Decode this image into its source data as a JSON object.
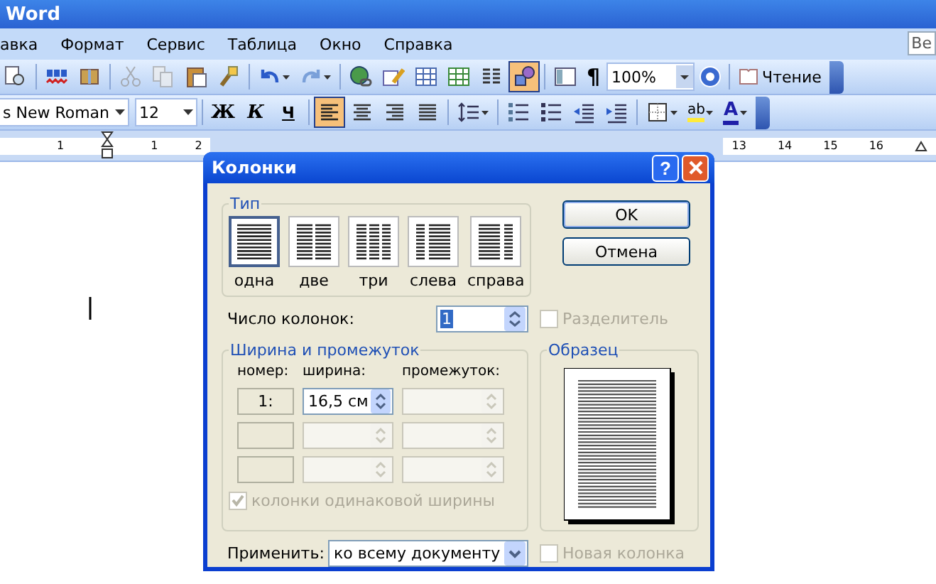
{
  "window": {
    "title": "Word"
  },
  "menu": [
    "авка",
    "Формат",
    "Сервис",
    "Таблица",
    "Окно",
    "Справка"
  ],
  "question_box": "Ве",
  "standard_toolbar": {
    "tools": [
      {
        "kind": "preview",
        "selected": false,
        "disabled": false,
        "dropdown": false
      },
      {
        "kind": "spelling",
        "selected": false,
        "disabled": false,
        "dropdown": false
      },
      {
        "kind": "research",
        "selected": false,
        "disabled": false,
        "dropdown": false
      },
      {
        "kind": "cut",
        "selected": false,
        "disabled": true,
        "dropdown": false
      },
      {
        "kind": "copy",
        "selected": false,
        "disabled": true,
        "dropdown": false
      },
      {
        "kind": "paste",
        "selected": false,
        "disabled": false,
        "dropdown": false
      },
      {
        "kind": "format-painter",
        "selected": false,
        "disabled": false,
        "dropdown": false
      },
      {
        "kind": "undo",
        "selected": false,
        "disabled": false,
        "dropdown": true
      },
      {
        "kind": "redo",
        "selected": false,
        "disabled": false,
        "dropdown": true
      },
      {
        "kind": "hyperlink",
        "selected": false,
        "disabled": false,
        "dropdown": false
      },
      {
        "kind": "tables-borders",
        "selected": false,
        "disabled": false,
        "dropdown": false
      },
      {
        "kind": "insert-table",
        "selected": false,
        "disabled": false,
        "dropdown": false
      },
      {
        "kind": "insert-worksheet",
        "selected": false,
        "disabled": false,
        "dropdown": false
      },
      {
        "kind": "columns",
        "selected": false,
        "disabled": false,
        "dropdown": false
      },
      {
        "kind": "drawing",
        "selected": true,
        "disabled": false,
        "dropdown": false
      },
      {
        "kind": "document-map",
        "selected": false,
        "disabled": false,
        "dropdown": false
      }
    ],
    "pilcrow": "¶",
    "zoom": "100%",
    "reading": "Чтение"
  },
  "formatting_toolbar": {
    "font": "s New Roman",
    "size": "12",
    "styles": [
      "Ж",
      "К",
      "Ч"
    ],
    "tools": [
      {
        "kind": "align-left",
        "selected": true,
        "dropdown": false
      },
      {
        "kind": "align-center",
        "selected": false,
        "dropdown": false
      },
      {
        "kind": "align-right",
        "selected": false,
        "dropdown": false
      },
      {
        "kind": "justify",
        "selected": false,
        "dropdown": false
      },
      {
        "kind": "line-spacing",
        "selected": false,
        "dropdown": true
      },
      {
        "kind": "numbering",
        "selected": false,
        "dropdown": false
      },
      {
        "kind": "bullets",
        "selected": false,
        "dropdown": false
      },
      {
        "kind": "outdent",
        "selected": false,
        "dropdown": false
      },
      {
        "kind": "indent",
        "selected": false,
        "dropdown": false
      },
      {
        "kind": "borders",
        "selected": false,
        "dropdown": true
      },
      {
        "kind": "highlight",
        "selected": false,
        "dropdown": true,
        "label": "ab"
      },
      {
        "kind": "font-color",
        "selected": false,
        "dropdown": true,
        "label": "A"
      }
    ]
  },
  "ruler": {
    "left_labels": [
      "1",
      "1",
      "2"
    ],
    "right_labels": [
      "13",
      "14",
      "15",
      "16"
    ]
  },
  "dialog": {
    "title": "Колонки",
    "help": "?",
    "type_group": {
      "title": "Тип",
      "presets": [
        {
          "kind": "one",
          "label": "одна",
          "selected": true
        },
        {
          "kind": "two",
          "label": "две",
          "selected": false
        },
        {
          "kind": "three",
          "label": "три",
          "selected": false
        },
        {
          "kind": "left",
          "label": "слева",
          "selected": false
        },
        {
          "kind": "right",
          "label": "справа",
          "selected": false
        }
      ]
    },
    "buttons": [
      "OK",
      "Отмена"
    ],
    "count_label": "Число колонок:",
    "count_value": "1",
    "separator": {
      "label": "Разделитель",
      "checked": false,
      "disabled": true
    },
    "width_group": {
      "title": "Ширина и промежуток",
      "headers": [
        "номер:",
        "ширина:",
        "промежуток:"
      ],
      "rows": [
        {
          "number": "1:",
          "width": "16,5 см",
          "disabled": false
        },
        {
          "disabled": true
        },
        {
          "disabled": true
        }
      ],
      "equal": {
        "label": "колонки одинаковой ширины",
        "checked": true,
        "disabled": true
      }
    },
    "sample_title": "Образец",
    "apply_label": "Применить:",
    "apply_value": "ко всему документу",
    "new_column": {
      "label": "Новая колонка",
      "checked": false,
      "disabled": true
    }
  }
}
